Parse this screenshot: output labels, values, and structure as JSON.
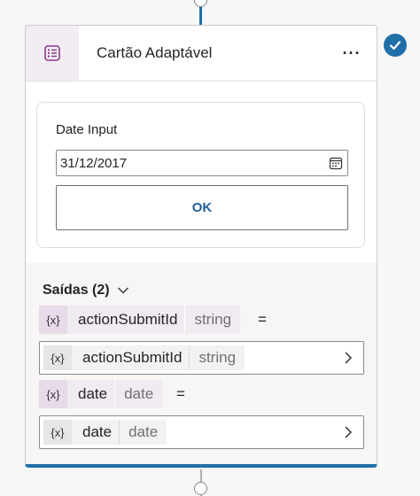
{
  "card": {
    "title": "Cartão Adaptável",
    "more_label": "···",
    "icon": "adaptive-card-icon"
  },
  "preview": {
    "date_label": "Date Input",
    "date_value": "31/12/2017",
    "ok_label": "OK"
  },
  "outputs": {
    "header": "Saídas (2)",
    "variables": [
      {
        "x_label": "{x}",
        "name": "actionSubmitId",
        "type": "string",
        "equals": "=",
        "value": {
          "x_label": "{x}",
          "name": "actionSubmitId",
          "type": "string"
        }
      },
      {
        "x_label": "{x}",
        "name": "date",
        "type": "date",
        "equals": "=",
        "value": {
          "x_label": "{x}",
          "name": "date",
          "type": "date"
        }
      }
    ]
  },
  "colors": {
    "accent": "#1f6fa8",
    "icon_purple": "#8b3a8b",
    "pill_bg": "#f0ebf1"
  }
}
